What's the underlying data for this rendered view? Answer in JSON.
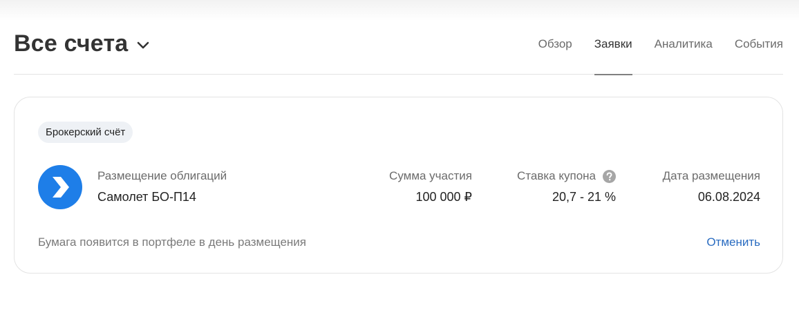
{
  "header": {
    "title": "Все счета",
    "tabs": [
      {
        "label": "Обзор",
        "active": false
      },
      {
        "label": "Заявки",
        "active": true
      },
      {
        "label": "Аналитика",
        "active": false
      },
      {
        "label": "События",
        "active": false
      }
    ],
    "dropdown_icon": "chevron-down-icon"
  },
  "order": {
    "account_badge": "Брокерский счёт",
    "issuer_logo_icon": "issuer-arrow-logo",
    "logo_color": "#1e7ee8",
    "type_label": "Размещение облигаций",
    "instrument_name": "Самолет БО-П14",
    "amount_label": "Сумма участия",
    "amount_value": "100 000 ₽",
    "coupon_label": "Ставка купона",
    "coupon_help_icon": "question-circle-icon",
    "coupon_value": "20,7 - 21 %",
    "date_label": "Дата размещения",
    "date_value": "06.08.2024",
    "note": "Бумага появится в портфеле в день размещения",
    "cancel_label": "Отменить",
    "link_color": "#2a6cc1"
  }
}
